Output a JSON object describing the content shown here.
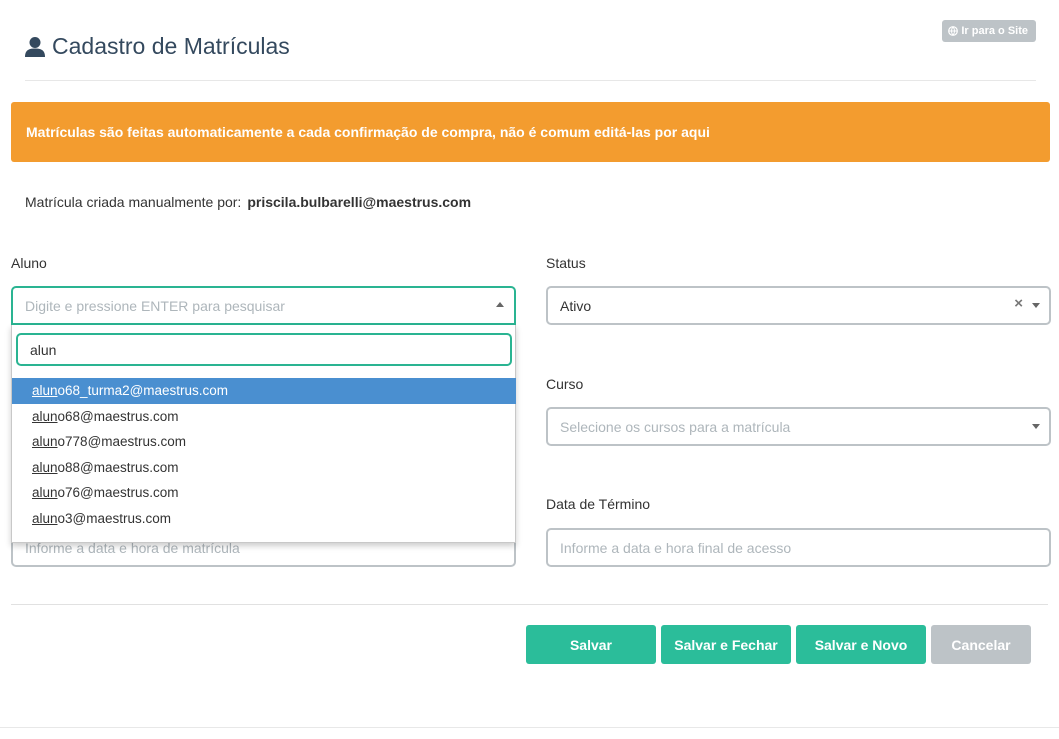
{
  "header": {
    "title": "Cadastro de Matrículas",
    "site_button": "Ir para o Site"
  },
  "alert": {
    "text": "Matrículas são feitas automaticamente a cada confirmação de compra, não é comum editá-las por aqui"
  },
  "creator": {
    "label": "Matrícula criada manualmente por:",
    "email": "priscila.bulbarelli@maestrus.com"
  },
  "form": {
    "aluno": {
      "label": "Aluno",
      "placeholder": "Digite e pressione ENTER para pesquisar",
      "search_value": "alun",
      "options": [
        {
          "match": "alun",
          "rest": "o68_turma2@maestrus.com",
          "highlighted": true
        },
        {
          "match": "alun",
          "rest": "o68@maestrus.com",
          "highlighted": false
        },
        {
          "match": "alun",
          "rest": "o778@maestrus.com",
          "highlighted": false
        },
        {
          "match": "alun",
          "rest": "o88@maestrus.com",
          "highlighted": false
        },
        {
          "match": "alun",
          "rest": "o76@maestrus.com",
          "highlighted": false
        },
        {
          "match": "alun",
          "rest": "o3@maestrus.com",
          "highlighted": false
        }
      ]
    },
    "status": {
      "label": "Status",
      "value": "Ativo"
    },
    "curso": {
      "label": "Curso",
      "placeholder": "Selecione os cursos para a matrícula"
    },
    "data_inicio": {
      "placeholder": "Informe a data e hora de matrícula"
    },
    "data_termino": {
      "label": "Data de Término",
      "placeholder": "Informe a data e hora final de acesso"
    }
  },
  "buttons": {
    "save": "Salvar",
    "save_close": "Salvar e Fechar",
    "save_new": "Salvar e Novo",
    "cancel": "Cancelar"
  },
  "colors": {
    "primary": "#2bbd9a",
    "warning": "#f39c2f",
    "highlight": "#4a8fd0",
    "muted": "#bdc3c7",
    "title": "#34495e"
  },
  "icons": {
    "title": "user-icon",
    "site_button": "globe-icon",
    "status_clear": "close-icon",
    "select_arrow": "caret-down-icon"
  }
}
